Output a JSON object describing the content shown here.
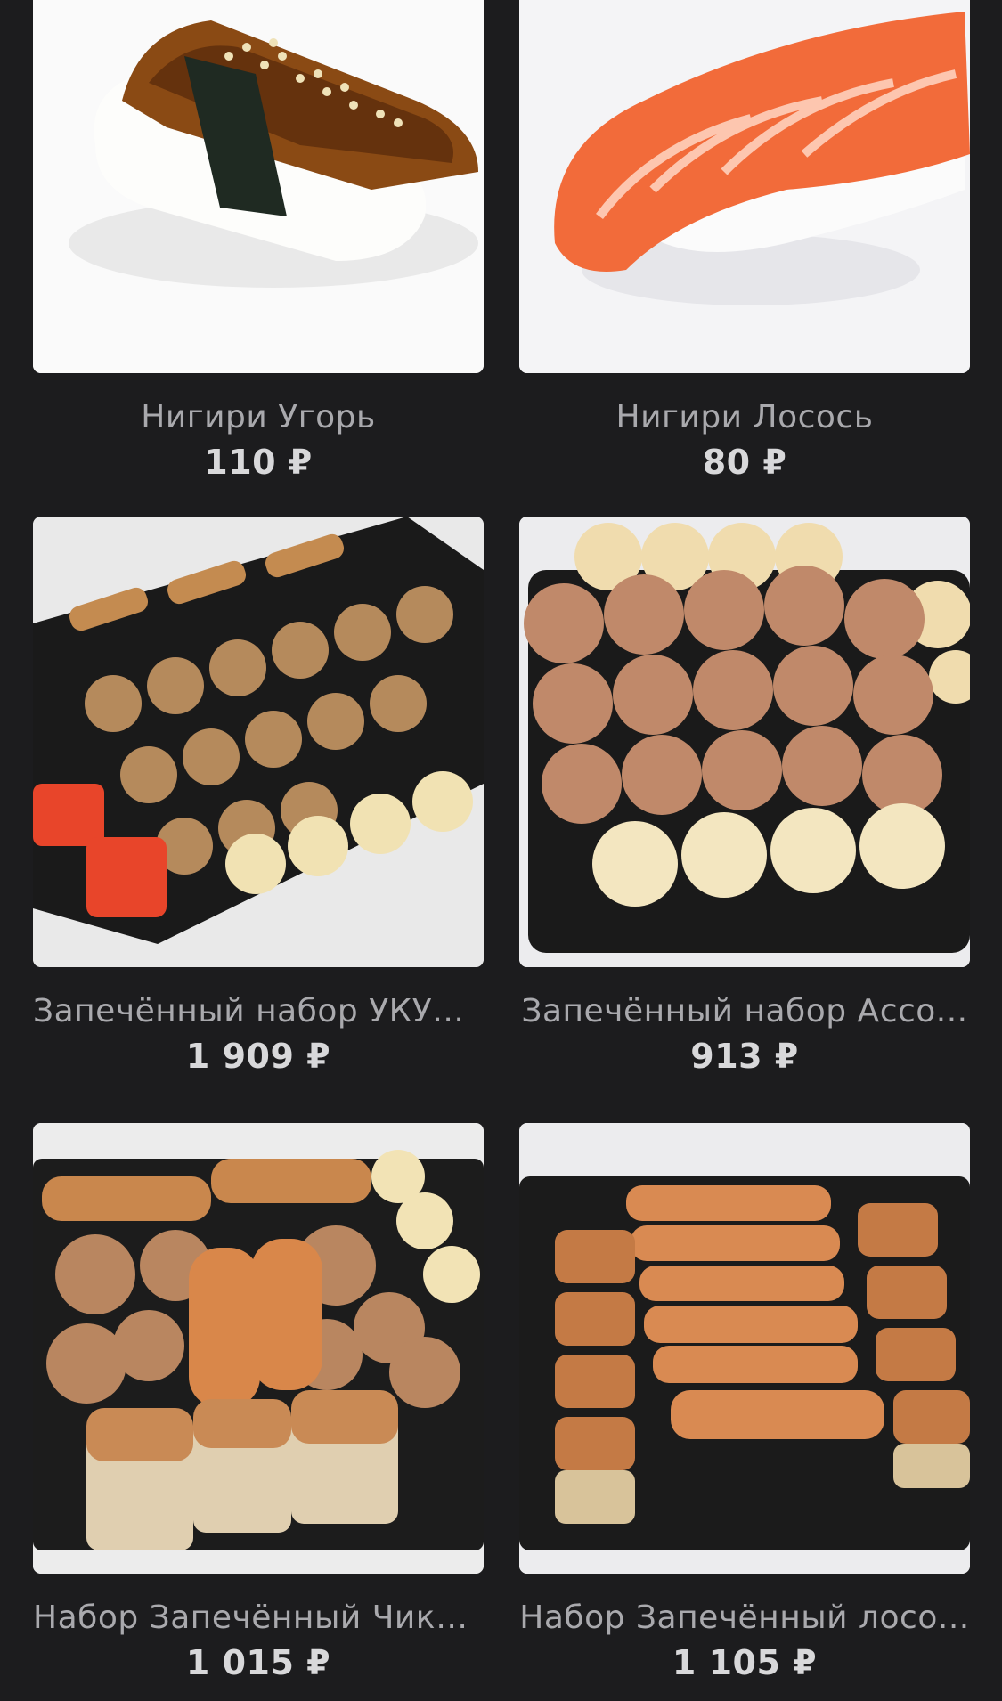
{
  "products": [
    {
      "name": "Нигири Угорь",
      "price": "110 ₽",
      "image": "eel-nigiri-photo"
    },
    {
      "name": "Нигири Лосось",
      "price": "80 ₽",
      "image": "salmon-nigiri-photo"
    },
    {
      "name": "Запечённый набор УКУШУ",
      "price": "1 909 ₽",
      "image": "baked-set-ukushu-photo"
    },
    {
      "name": "Запечённый набор Ассо...",
      "price": "913 ₽",
      "image": "baked-set-assorted-photo"
    },
    {
      "name": "Набор Запечённый Чике...",
      "price": "1 015 ₽",
      "image": "baked-set-chicken-photo"
    },
    {
      "name": "Набор Запечённый лосо...",
      "price": "1 105 ₽",
      "image": "baked-set-salmon-photo"
    }
  ],
  "colors": {
    "background": "#1c1c1e",
    "name_text": "#a9a9ad",
    "price_text": "#d8d8da"
  }
}
